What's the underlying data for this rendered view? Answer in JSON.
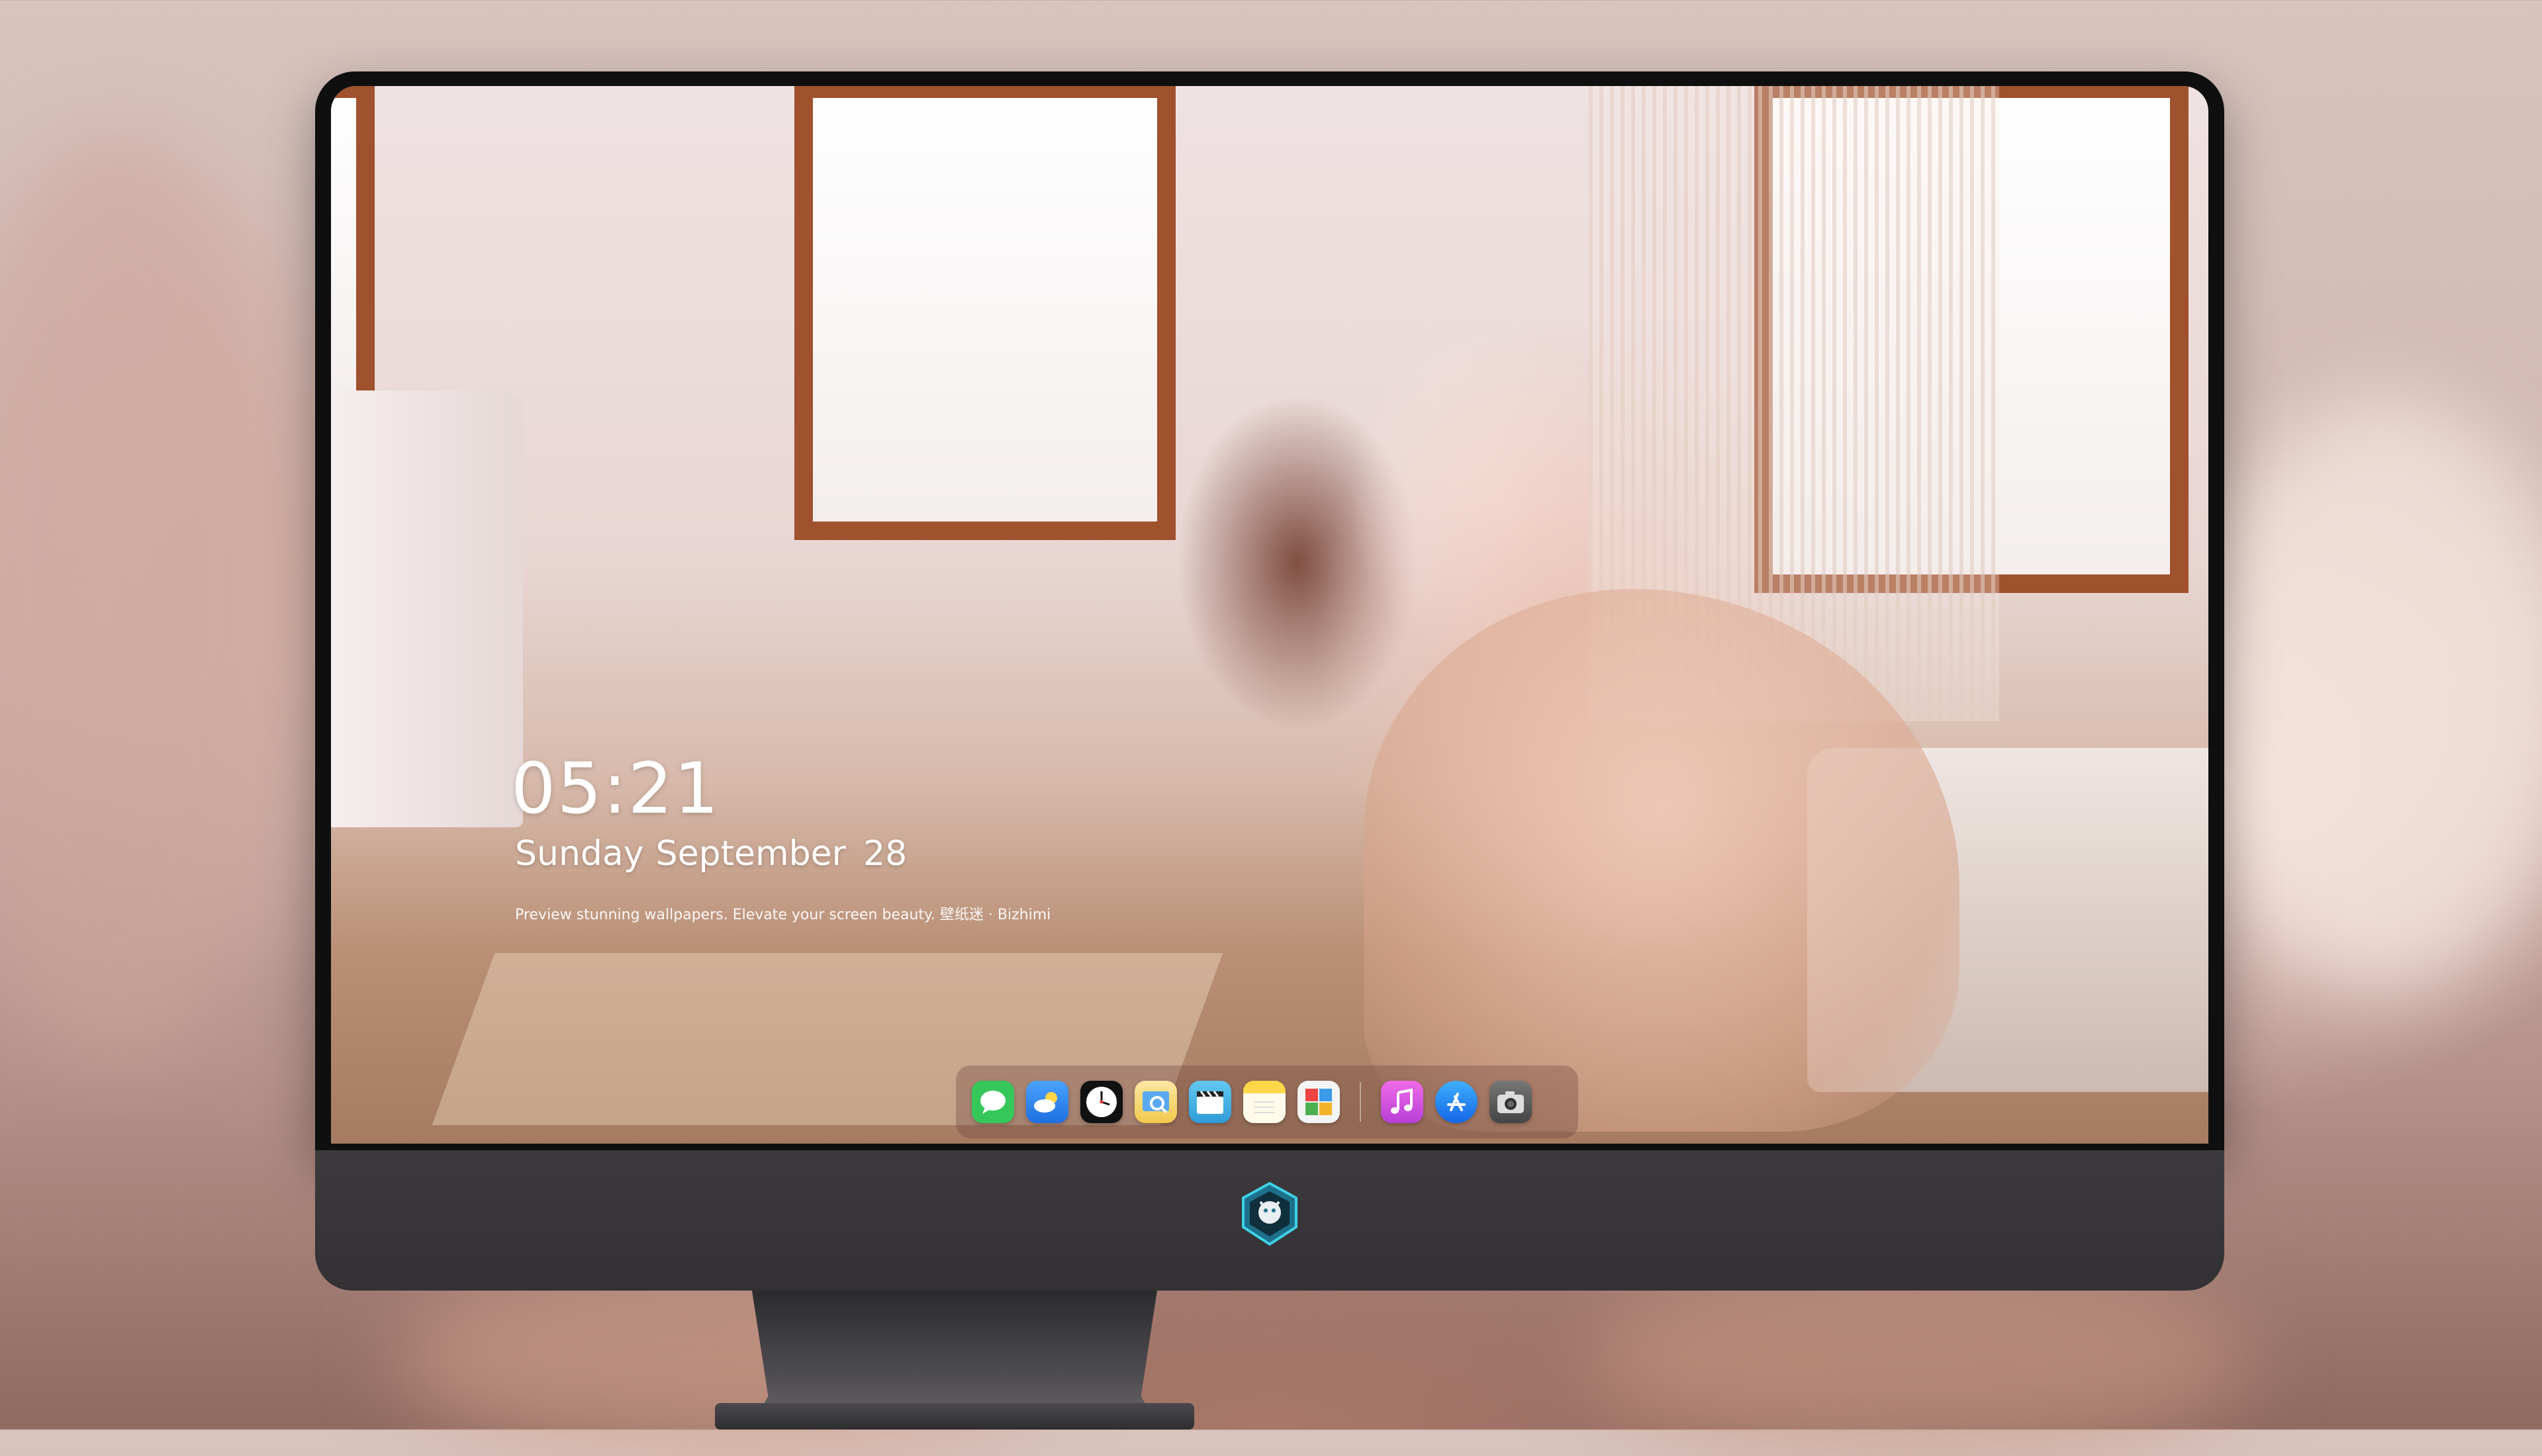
{
  "lockscreen": {
    "time": "05:21",
    "weekday": "Sunday",
    "month": "September",
    "day": "28",
    "tagline": "Preview stunning wallpapers. Elevate your screen beauty. 壁纸迷 · Bizhimi"
  },
  "dock": {
    "apps": [
      {
        "name": "messages",
        "icon": "messages-icon",
        "color": "#35c759"
      },
      {
        "name": "weather",
        "icon": "weather-icon",
        "color": "#3a8ef6"
      },
      {
        "name": "clock",
        "icon": "clock-icon",
        "color": "#111111"
      },
      {
        "name": "preview",
        "icon": "preview-icon",
        "color": "#f2c94c"
      },
      {
        "name": "clips",
        "icon": "clips-icon",
        "color": "#45b0e6"
      },
      {
        "name": "notes",
        "icon": "notes-icon",
        "color": "#f7d64a"
      },
      {
        "name": "photo-booth",
        "icon": "photo-booth-icon",
        "color": "#5ab45e"
      },
      {
        "name": "music",
        "icon": "music-icon",
        "color": "#d84dde"
      },
      {
        "name": "app-store",
        "icon": "app-store-icon",
        "color": "#1a84f0"
      },
      {
        "name": "camera",
        "icon": "camera-icon",
        "color": "#555555"
      }
    ]
  },
  "monitor": {
    "logo_icon": "dragon-shield-logo"
  }
}
